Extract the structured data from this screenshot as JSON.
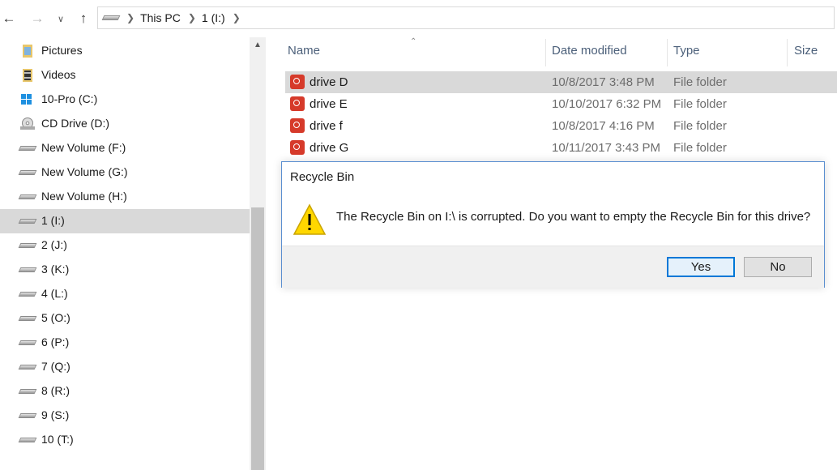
{
  "nav": {
    "back_icon": "back-arrow-icon",
    "forward_icon": "forward-arrow-icon",
    "recent_icon": "chevron-down-icon",
    "up_icon": "up-arrow-icon"
  },
  "address": {
    "crumbs": [
      "This PC",
      "1 (I:)"
    ]
  },
  "sidebar": {
    "items": [
      {
        "label": "Pictures",
        "icon": "pictures-folder-icon"
      },
      {
        "label": "Videos",
        "icon": "videos-folder-icon"
      },
      {
        "label": "10-Pro (C:)",
        "icon": "windows-drive-icon"
      },
      {
        "label": "CD Drive (D:)",
        "icon": "cd-drive-icon"
      },
      {
        "label": "New Volume (F:)",
        "icon": "drive-icon"
      },
      {
        "label": "New Volume (G:)",
        "icon": "drive-icon"
      },
      {
        "label": "New Volume (H:)",
        "icon": "drive-icon"
      },
      {
        "label": "1 (I:)",
        "icon": "drive-icon"
      },
      {
        "label": "2 (J:)",
        "icon": "drive-icon"
      },
      {
        "label": "3 (K:)",
        "icon": "drive-icon"
      },
      {
        "label": "4 (L:)",
        "icon": "drive-icon"
      },
      {
        "label": "5 (O:)",
        "icon": "drive-icon"
      },
      {
        "label": "6 (P:)",
        "icon": "drive-icon"
      },
      {
        "label": "7 (Q:)",
        "icon": "drive-icon"
      },
      {
        "label": "8 (R:)",
        "icon": "drive-icon"
      },
      {
        "label": "9 (S:)",
        "icon": "drive-icon"
      },
      {
        "label": "10 (T:)",
        "icon": "drive-icon"
      }
    ],
    "selected_index": 7
  },
  "filelist": {
    "columns": [
      "Name",
      "Date modified",
      "Type",
      "Size"
    ],
    "rows": [
      {
        "name": "drive D",
        "date": "10/8/2017 3:48 PM",
        "type": "File folder"
      },
      {
        "name": "drive E",
        "date": "10/10/2017 6:32 PM",
        "type": "File folder"
      },
      {
        "name": "drive f",
        "date": "10/8/2017 4:16 PM",
        "type": "File folder"
      },
      {
        "name": "drive G",
        "date": "10/11/2017 3:43 PM",
        "type": "File folder"
      }
    ]
  },
  "dialog": {
    "title": "Recycle Bin",
    "message": "The Recycle Bin on I:\\ is corrupted. Do you want to empty the Recycle Bin for this drive?",
    "icon": "warning-icon",
    "yes_label": "Yes",
    "no_label": "No"
  },
  "colors": {
    "accent": "#0078d7",
    "selection": "#d9d9d9",
    "header_text": "#4c607a"
  }
}
